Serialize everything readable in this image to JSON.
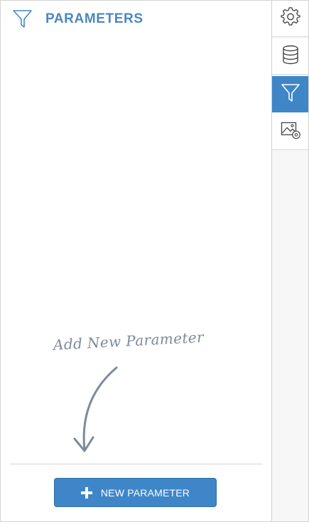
{
  "panel": {
    "title": "PARAMETERS",
    "header_icon": "filter-icon",
    "empty_hint": "Add New Parameter",
    "new_button_label": "NEW PARAMETER",
    "new_button_icon": "plus-icon"
  },
  "rail": {
    "items": [
      {
        "icon": "gear-icon",
        "active": false
      },
      {
        "icon": "database-icon",
        "active": false
      },
      {
        "icon": "filter-icon",
        "active": true
      },
      {
        "icon": "image-settings-icon",
        "active": false
      }
    ]
  },
  "colors": {
    "accent": "#3f86c8",
    "title": "#4a87c3",
    "hint": "#7d8a99",
    "icon": "#444444"
  }
}
